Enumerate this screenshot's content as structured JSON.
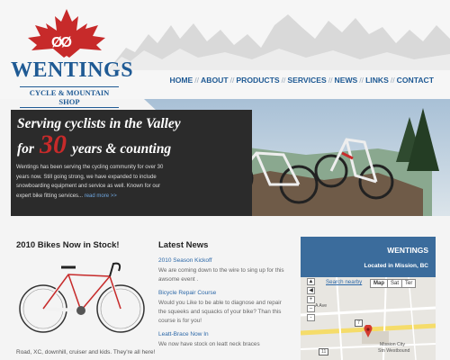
{
  "logo": {
    "brand": "WENTINGS",
    "tagline": "CYCLE & MOUNTAIN SHOP",
    "bike_glyph": "ØØ"
  },
  "nav": {
    "items": [
      "HOME",
      "ABOUT",
      "PRODUCTS",
      "SERVICES",
      "NEWS",
      "LINKS",
      "CONTACT"
    ],
    "separator": "//"
  },
  "hero": {
    "line1": "Serving cyclists in the Valley",
    "line2_pre": "for",
    "line2_num": "30",
    "line2_post": "years & counting",
    "body": "Wentings has been serving the cycling community for over 30 years now. Still going strong, we have expanded to include snowboarding equipment and service as well. Known for our expert bike fitting services...",
    "more": "read more >>"
  },
  "bikes": {
    "title": "2010 Bikes Now in Stock!",
    "caption": "Road, XC, downhill, cruiser and kids. They're all here!"
  },
  "news": {
    "title": "Latest News",
    "items": [
      {
        "title": "2010 Season Kickoff",
        "body": "We are coming down to the wire to sing up for this awsome event ."
      },
      {
        "title": "Bicycle Repair Course",
        "body": "Would you Like to be able to diagnose and repair the squeeks and squacks of your bike? Than this course is for you!"
      },
      {
        "title": "Leatt-Brace Now In",
        "body": "We now have stock on leatt neck braces"
      }
    ]
  },
  "map": {
    "name": "WENTINGS",
    "location": "Located in Mission, BC",
    "search_nearby": "Search nearby",
    "types": [
      "Map",
      "Sat",
      "Ter"
    ],
    "active_type": "Map",
    "labels": {
      "ave": "A Ave",
      "highway_num": "7",
      "city": "Mission City",
      "station": "Stn Westbound",
      "highway_shield": "11"
    }
  },
  "colors": {
    "brand_blue": "#1f5a94",
    "accent_red": "#c72a2a",
    "link_blue": "#2c68a8",
    "hero_panel": "#2b2b2b",
    "map_header": "#3b6c9c"
  }
}
